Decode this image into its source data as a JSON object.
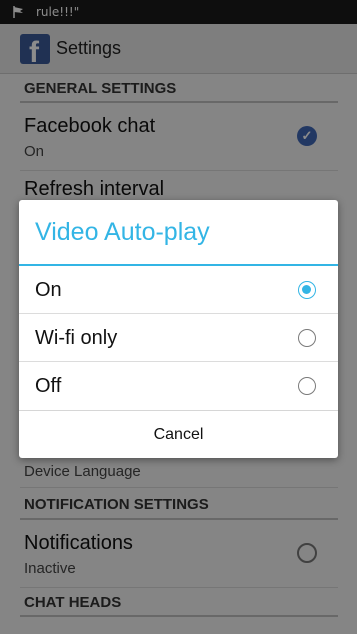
{
  "status_bar": {
    "text": "rule!!!\"",
    "icon": "flag-icon"
  },
  "action_bar": {
    "title": "Settings",
    "logo": "f"
  },
  "sections": {
    "general": "GENERAL SETTINGS",
    "notification": "NOTIFICATION SETTINGS",
    "chat_heads": "CHAT HEADS"
  },
  "items": {
    "facebook_chat": {
      "title": "Facebook chat",
      "summary": "On"
    },
    "refresh_interval": {
      "title": "Refresh interval"
    },
    "language": {
      "summary": "Device Language"
    },
    "notifications": {
      "title": "Notifications",
      "summary": "Inactive"
    }
  },
  "dialog": {
    "title": "Video Auto-play",
    "options": [
      {
        "label": "On",
        "selected": true
      },
      {
        "label": "Wi-fi only",
        "selected": false
      },
      {
        "label": "Off",
        "selected": false
      }
    ],
    "cancel_label": "Cancel"
  },
  "colors": {
    "accent": "#33b5e5",
    "facebook_blue": "#3b5998"
  }
}
